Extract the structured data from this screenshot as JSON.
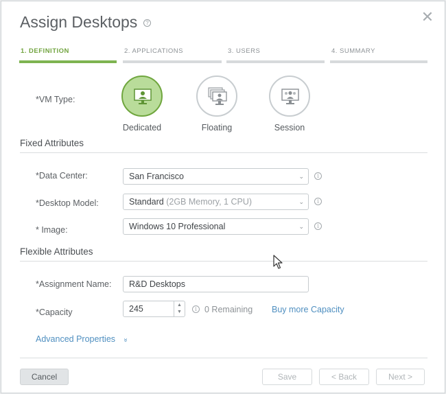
{
  "dialog": {
    "title": "Assign Desktops",
    "help_icon": "question-circle-icon",
    "close_icon": "close-icon"
  },
  "steps": [
    {
      "label": "1. DEFINITION",
      "active": true
    },
    {
      "label": "2. APPLICATIONS",
      "active": false
    },
    {
      "label": "3. USERS",
      "active": false
    },
    {
      "label": "4. SUMMARY",
      "active": false
    }
  ],
  "vm_type": {
    "label": "*VM Type:",
    "selected": "Dedicated",
    "options": [
      {
        "label": "Dedicated",
        "icon": "dedicated-desktop-icon"
      },
      {
        "label": "Floating",
        "icon": "floating-desktops-icon"
      },
      {
        "label": "Session",
        "icon": "session-desktop-icon"
      }
    ]
  },
  "fixed_attributes": {
    "title": "Fixed Attributes",
    "data_center": {
      "label": "*Data Center:",
      "value": "San Francisco"
    },
    "desktop_model": {
      "label": "*Desktop Model:",
      "value": "Standard",
      "detail": "(2GB Memory, 1 CPU)"
    },
    "image": {
      "label": "* Image:",
      "value": "Windows 10 Professional"
    }
  },
  "flexible_attributes": {
    "title": "Flexible Attributes",
    "assignment_name": {
      "label": "*Assignment Name:",
      "value": "R&D Desktops"
    },
    "capacity": {
      "label": "*Capacity",
      "value": "245",
      "remaining": "0 Remaining",
      "buy_link": "Buy more Capacity"
    },
    "advanced_link": "Advanced Properties",
    "advanced_chevron": "»"
  },
  "footer": {
    "cancel": "Cancel",
    "save": "Save",
    "back": "< Back",
    "next": "Next >"
  },
  "colors": {
    "accent_green": "#7eb451",
    "selected_fill": "#b9dc9a",
    "link_blue": "#4f8fc0"
  }
}
